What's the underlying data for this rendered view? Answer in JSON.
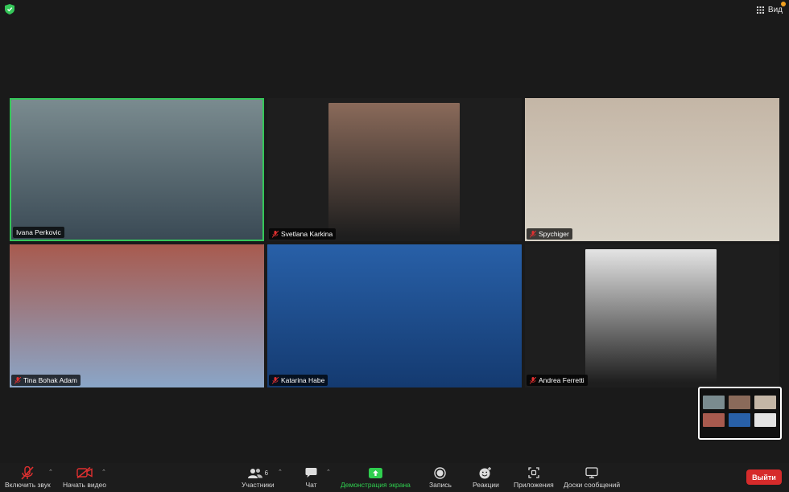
{
  "app": {
    "view_label": "Вид"
  },
  "participants": [
    {
      "name": "Ivana Perkovic",
      "muted": false,
      "speaking": true,
      "bg": "#3a4a55",
      "photo": "#7a8b8f"
    },
    {
      "name": "Svetlana Karkina",
      "muted": true,
      "speaking": false,
      "bg": "#1e1e1e",
      "photo": "#8a6a5a"
    },
    {
      "name": "Spychiger",
      "muted": true,
      "speaking": false,
      "bg": "#d8d2c6",
      "photo": "#c4b6a6"
    },
    {
      "name": "Tina Bohak Adam",
      "muted": true,
      "speaking": false,
      "bg": "#8aa6c8",
      "photo": "#a85a4e"
    },
    {
      "name": "Katarina Habe",
      "muted": true,
      "speaking": false,
      "bg": "#143a70",
      "photo": "#2860a8"
    },
    {
      "name": "Andrea Ferretti",
      "muted": true,
      "speaking": false,
      "bg": "#1e1e1e",
      "photo": "#e4e4e4"
    }
  ],
  "toolbar": {
    "audio_label": "Включить звук",
    "video_label": "Начать видео",
    "participants_label": "Участники",
    "participants_count": "6",
    "chat_label": "Чат",
    "share_label": "Демонстрация экрана",
    "record_label": "Запись",
    "reactions_label": "Реакции",
    "apps_label": "Приложения",
    "whiteboards_label": "Доски сообщений",
    "leave_label": "Выйти"
  },
  "colors": {
    "speaking_border": "#35c759",
    "share_green": "#2fcf4f",
    "leave_red": "#d62b2b",
    "mute_red": "#e03030"
  }
}
